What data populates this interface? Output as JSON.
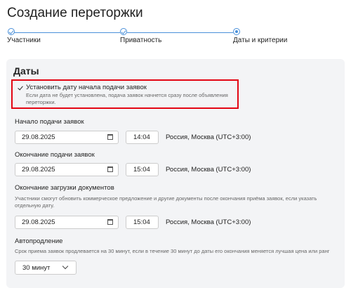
{
  "header": {
    "title": "Создание переторжки"
  },
  "stepper": {
    "steps": [
      {
        "label": "Участники",
        "state": "done"
      },
      {
        "label": "Приватность",
        "state": "done"
      },
      {
        "label": "Даты и критерии",
        "state": "current"
      }
    ],
    "accent_color": "#4a90d9"
  },
  "dates": {
    "title": "Даты",
    "set_start": {
      "checked": true,
      "label": "Установить дату начала подачи заявок",
      "hint": "Если дата не будет установлена, подача заявок начнется сразу после объявления переторжки."
    },
    "start": {
      "label": "Начало подачи заявок",
      "date": "29.08.2025",
      "time": "14:04",
      "tz": "Россия, Москва (UTC+3:00)"
    },
    "end": {
      "label": "Окончание подачи заявок",
      "date": "29.08.2025",
      "time": "15:04",
      "tz": "Россия, Москва (UTC+3:00)"
    },
    "docs": {
      "label": "Окончание загрузки документов",
      "hint": "Участники смогут обновить коммерческое предложение и другие документы после окончания приёма заявок, если указать отдельную дату.",
      "date": "29.08.2025",
      "time": "15:04",
      "tz": "Россия, Москва (UTC+3:00)"
    },
    "extension": {
      "label": "Автопродление",
      "hint": "Срок приема заявок продлевается на 30 минут, если в течение 30 минут до даты его окончания меняется лучшая цена или ранг",
      "value": "30 минут"
    }
  },
  "highlight_color": "#e30613"
}
